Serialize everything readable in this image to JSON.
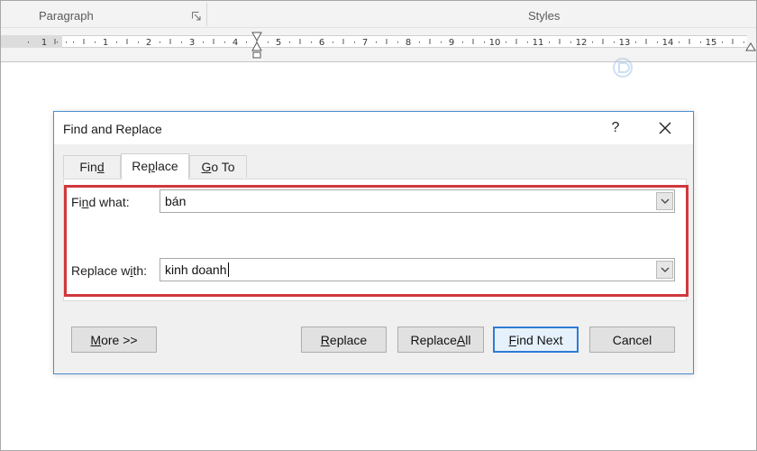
{
  "ribbon": {
    "paragraph_group": "Paragraph",
    "styles_group": "Styles"
  },
  "ruler": {
    "left_labels": [
      "1"
    ],
    "labels": [
      "1",
      "2",
      "3",
      "4",
      "5",
      "6",
      "7",
      "8",
      "9",
      "10",
      "11",
      "12",
      "13",
      "14",
      "15"
    ]
  },
  "dialog": {
    "title": "Find and Replace",
    "help": "?",
    "tabs": [
      {
        "pre": "Fin",
        "u": "d",
        "post": ""
      },
      {
        "pre": "Re",
        "u": "p",
        "post": "lace"
      },
      {
        "pre": "",
        "u": "G",
        "post": "o To"
      }
    ],
    "find_label": {
      "pre": "Fi",
      "u": "n",
      "post": "d what:"
    },
    "find_value": "bán",
    "replace_label": {
      "pre": "Replace w",
      "u": "i",
      "post": "th:"
    },
    "replace_value": "kinh doanh",
    "buttons": {
      "more": {
        "pre": "",
        "u": "M",
        "post": "ore >>"
      },
      "replace": {
        "pre": "",
        "u": "R",
        "post": "eplace"
      },
      "replace_all": {
        "pre": "Replace ",
        "u": "A",
        "post": "ll"
      },
      "find_next": {
        "pre": "",
        "u": "F",
        "post": "ind Next"
      },
      "cancel": "Cancel"
    }
  },
  "colors": {
    "highlight": "#d0383c",
    "dialog_border": "#4d8ccf",
    "default_button_border": "#2f7bd6"
  }
}
